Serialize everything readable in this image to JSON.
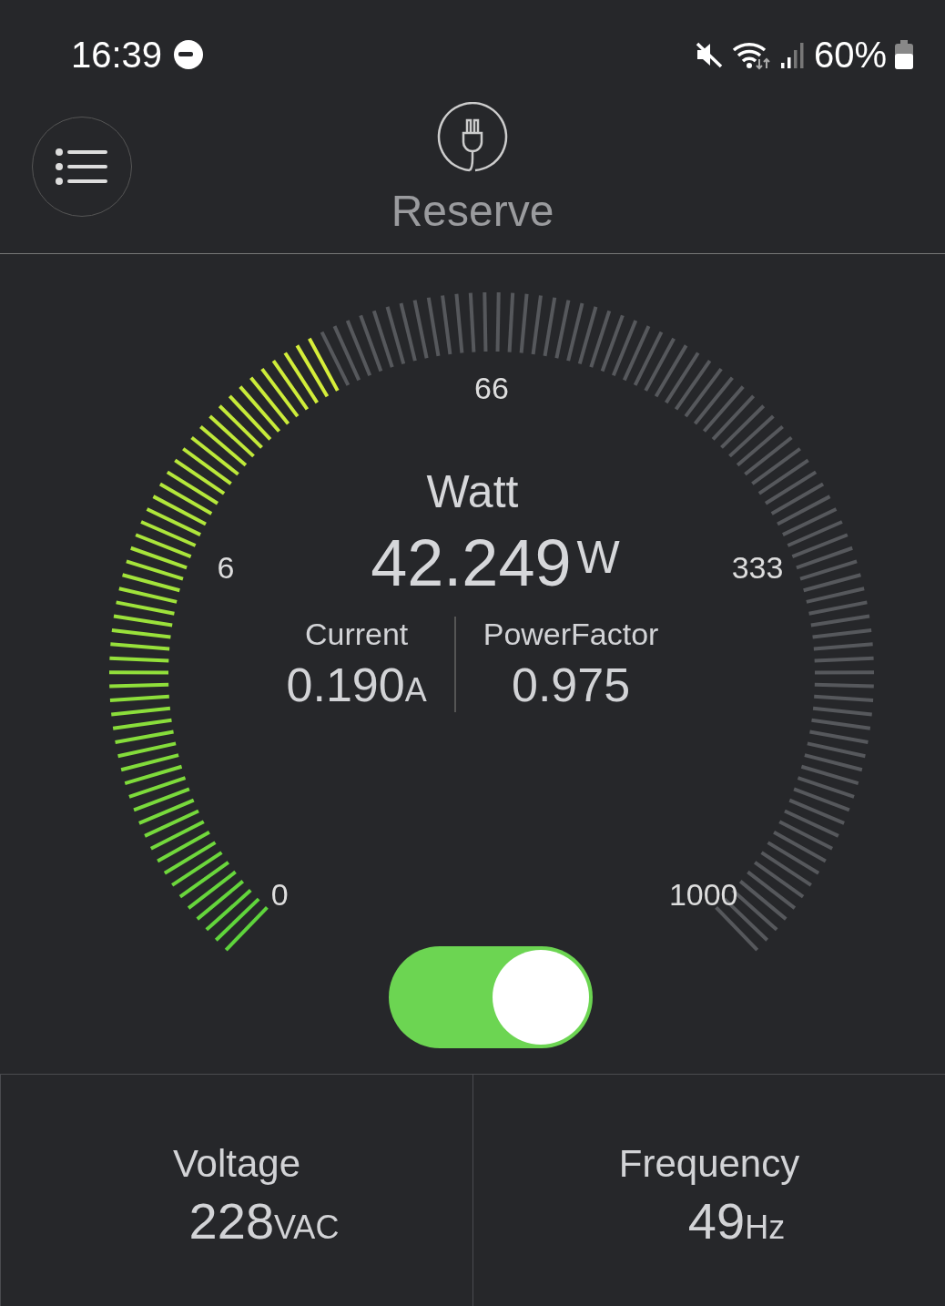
{
  "status_bar": {
    "time": "16:39",
    "battery_text": "60%"
  },
  "header": {
    "title": "Reserve"
  },
  "gauge": {
    "scale_labels": [
      "0",
      "6",
      "66",
      "333",
      "1000"
    ],
    "title": "Watt",
    "value": "42.249",
    "unit": "W",
    "readings": [
      {
        "label": "Current",
        "value": "0.190",
        "unit": "A"
      },
      {
        "label": "PowerFactor",
        "value": "0.975"
      }
    ]
  },
  "switch": {
    "on": true
  },
  "cards": [
    {
      "label": "Voltage",
      "value": "228",
      "unit": "VAC"
    },
    {
      "label": "Frequency",
      "value": "49",
      "unit": "Hz"
    }
  ]
}
